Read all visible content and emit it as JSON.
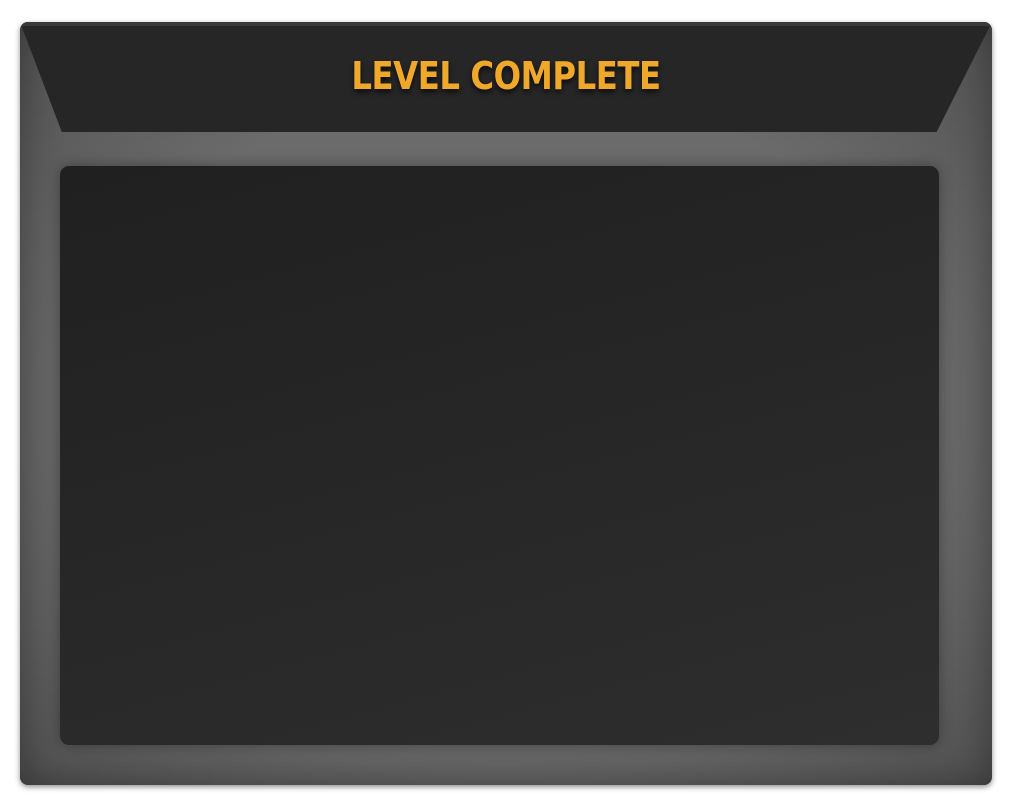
{
  "dialog": {
    "title": "LEVEL COMPLETE"
  },
  "colors": {
    "title": "#f0a82a",
    "frame": "#6b6b6b",
    "banner": "#262626",
    "panel": "#262626"
  }
}
